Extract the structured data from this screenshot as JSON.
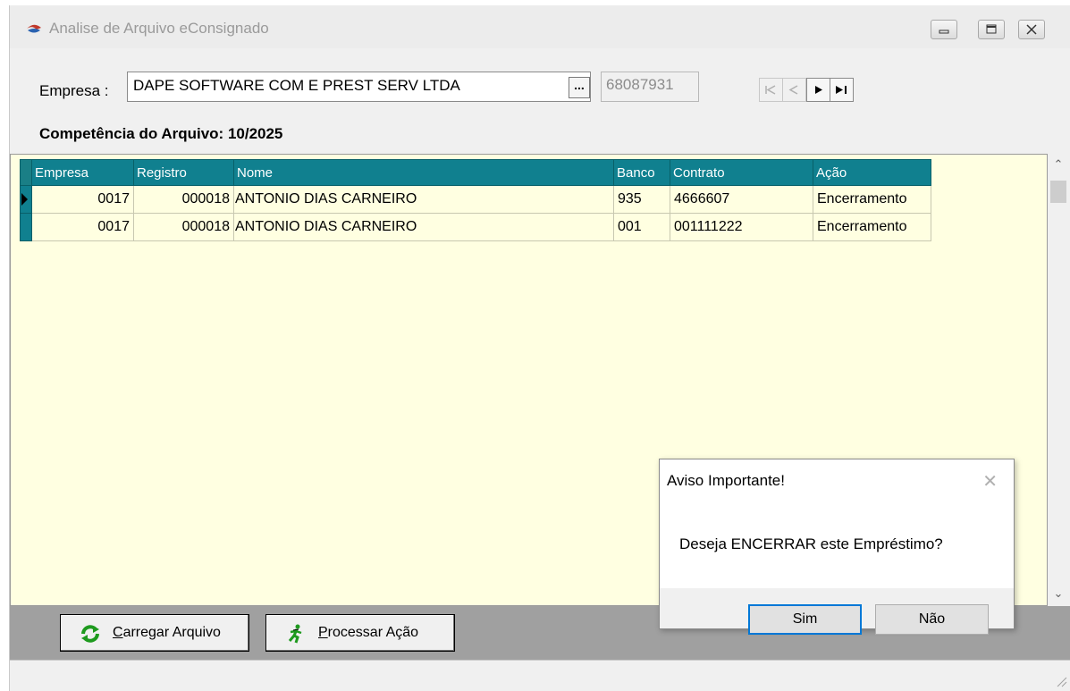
{
  "window": {
    "title": "Analise de Arquivo eConsignado",
    "controls": [
      "minimize-icon",
      "maximize-icon",
      "close-icon"
    ]
  },
  "header": {
    "empresa_label": "Empresa :",
    "empresa_value": "DAPE SOFTWARE COM E PREST SERV LTDA",
    "lookup_label": "...",
    "empresa_code": "68087931",
    "nav_icons": [
      "nav-first-icon",
      "nav-prior-icon",
      "nav-next-icon",
      "nav-last-icon"
    ],
    "competencia": "Competência do Arquivo: 10/2025"
  },
  "grid": {
    "columns": [
      "Empresa",
      "Registro",
      "Nome",
      "Banco",
      "Contrato",
      "Ação"
    ],
    "rows": [
      [
        "0017",
        "000018",
        "ANTONIO DIAS CARNEIRO",
        "935",
        "4666607",
        "Encerramento"
      ],
      [
        "0017",
        "000018",
        "ANTONIO DIAS CARNEIRO",
        "001",
        "001111222",
        "Encerramento"
      ]
    ],
    "selected_row": 0
  },
  "toolbar": {
    "carregar_label_hotkey": "C",
    "carregar_label_rest": "arregar Arquivo",
    "processar_label_hotkey": "P",
    "processar_label_rest": "rocessar Ação"
  },
  "dialog": {
    "title": "Aviso Importante!",
    "message": "Deseja ENCERRAR este Empréstimo?",
    "yes_label": "Sim",
    "no_label": "Não"
  },
  "colors": {
    "grid_header": "#10808f",
    "grid_background": "#ffffe1",
    "toolbar_background": "#a0a0a0",
    "default_button_border": "#0078d7"
  }
}
